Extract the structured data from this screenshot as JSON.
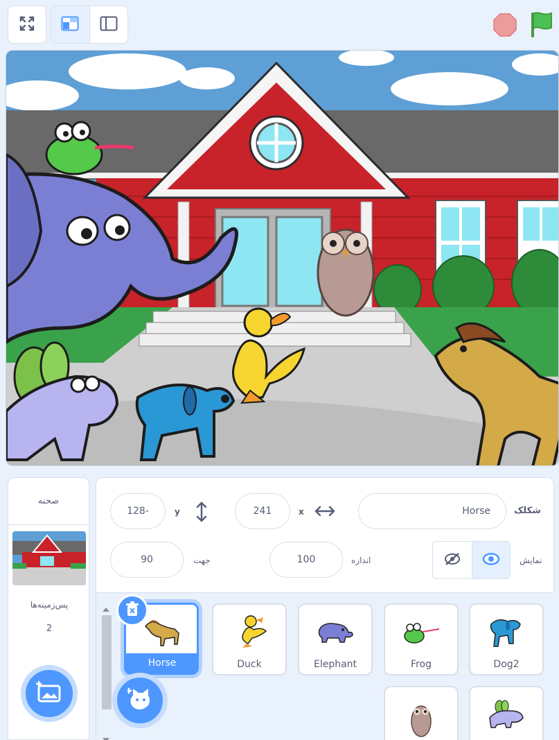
{
  "toolbar": {
    "fullscreen_icon": "fullscreen-icon",
    "small_stage_icon": "small-stage-icon",
    "large_stage_icon": "large-stage-icon",
    "stop_icon": "stop-icon",
    "green_flag_icon": "green-flag-icon",
    "stop_color": "#ec9c9c",
    "flag_color": "#4cbf56"
  },
  "stage_pane": {
    "title": "صحنه",
    "backdrops_label": "پس‌زمینه‌ها",
    "backdrops_count": "2",
    "choose_backdrop_icon": "backdrop-add-icon"
  },
  "sprite_info": {
    "sprite_label": "شکلک",
    "sprite_name": "Horse",
    "x_label": "x",
    "x_value": "241",
    "y_label": "y",
    "y_value": "128-",
    "show_label": "نمایش",
    "size_label": "اندازه",
    "size_value": "100",
    "direction_label": "جهت",
    "direction_value": "90",
    "visibility": "shown"
  },
  "sprites": [
    {
      "name": "Horse",
      "selected": true,
      "icon": "horse-icon"
    },
    {
      "name": "Duck",
      "selected": false,
      "icon": "duck-icon"
    },
    {
      "name": "Elephant",
      "selected": false,
      "icon": "elephant-icon"
    },
    {
      "name": "Frog",
      "selected": false,
      "icon": "frog-icon"
    },
    {
      "name": "Dog2",
      "selected": false,
      "icon": "dog-icon"
    },
    {
      "name": "",
      "selected": false,
      "icon": "owl-icon"
    },
    {
      "name": "",
      "selected": false,
      "icon": "hippo-icon"
    }
  ],
  "colors": {
    "accent": "#4d97ff",
    "panel_bg": "#e9f1fc",
    "text": "#575e75"
  }
}
